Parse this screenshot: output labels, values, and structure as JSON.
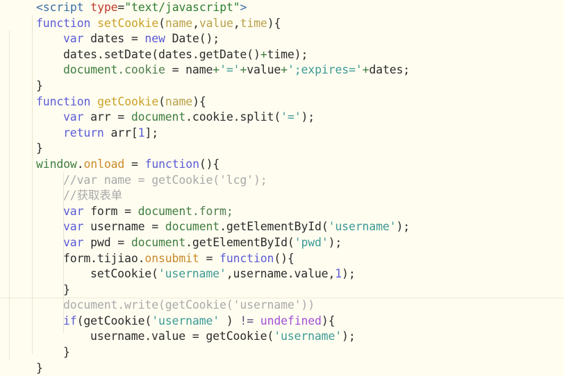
{
  "editor": {
    "name": "code-editor",
    "language": "html-javascript",
    "background_color": "#fffdf0",
    "guide_color": "#e8e4cf",
    "rule_color": "#eeead8",
    "colors": {
      "tag": "#3a6ea5",
      "attribute": "#c0392b",
      "attribute_string": "#2e7d32",
      "keyword": "#5b5bd6",
      "function_name": "#c9a227",
      "property": "#c98a2b",
      "parameter": "#b8a04a",
      "global": "#3f7d3f",
      "string": "#3c9a96",
      "number": "#5b5bd6",
      "comment": "#a9a9a9",
      "undefined_literal": "#a34fd6",
      "operator": "#5a4d7a",
      "default": "#2b2b2b"
    }
  },
  "code": {
    "line01": {
      "t1": "<script ",
      "t2": "type",
      "t3": "=",
      "t4": "\"text/javascript\"",
      "t5": ">"
    },
    "line02": {
      "t1": "function ",
      "t2": "setCookie",
      "t3": "(",
      "t4": "name",
      "t5": ",",
      "t6": "value",
      "t7": ",",
      "t8": "time",
      "t9": "){"
    },
    "line03": {
      "t1": "var ",
      "t2": "dates ",
      "t3": "= ",
      "t4": "new ",
      "t5": "Date();"
    },
    "line04": {
      "t1": "dates",
      "t2": ".setDate(",
      "t3": "dates",
      "t4": ".getDate()",
      "t5": "+",
      "t6": "time);"
    },
    "line05": {
      "t1": "document",
      "t2": ".cookie ",
      "t3": "= ",
      "t4": "name",
      "t5": "+",
      "t6": "'='",
      "t7": "+",
      "t8": "value",
      "t9": "+",
      "t10": "';expires='",
      "t11": "+",
      "t12": "dates;"
    },
    "line06": {
      "t1": "}"
    },
    "line07": {
      "t1": "function ",
      "t2": "getCookie",
      "t3": "(",
      "t4": "name",
      "t5": "){"
    },
    "line08": {
      "t1": "var ",
      "t2": "arr ",
      "t3": "= ",
      "t4": "document",
      "t5": ".cookie.split(",
      "t6": "'='",
      "t7": ");"
    },
    "line09": {
      "t1": "return ",
      "t2": "arr[",
      "t3": "1",
      "t4": "];"
    },
    "line10": {
      "t1": "}"
    },
    "line11": {
      "t1": "window",
      "t2": ".",
      "t3": "onload ",
      "t4": "= ",
      "t5": "function",
      "t6": "(){"
    },
    "line12": {
      "t1": "//var name = getCookie('lcg');"
    },
    "line13": {
      "t1": "//获取表单"
    },
    "line14": {
      "t1": "var ",
      "t2": "form ",
      "t3": "= ",
      "t4": "document",
      "t5": ".form;"
    },
    "line15": {
      "t1": "var ",
      "t2": "username ",
      "t3": "= ",
      "t4": "document",
      "t5": ".getElementById(",
      "t6": "'username'",
      "t7": ");"
    },
    "line16": {
      "t1": "var ",
      "t2": "pwd ",
      "t3": "= ",
      "t4": "document",
      "t5": ".getElementById(",
      "t6": "'pwd'",
      "t7": ");"
    },
    "line17": {
      "t1": "form.tijiao.",
      "t2": "onsubmit ",
      "t3": "= ",
      "t4": "function",
      "t5": "(){"
    },
    "line18": {
      "t1": "setCookie(",
      "t2": "'username'",
      "t3": ",username.value,",
      "t4": "1",
      "t5": ");"
    },
    "line19": {
      "t1": "}"
    },
    "line20": {
      "t1": "document.write(getCookie('username'))"
    },
    "line21": {
      "t1": "if",
      "t2": "(getCookie(",
      "t3": "'username'",
      "t4": " ) ",
      "t5": "!=",
      "t6": " ",
      "t7": "undefined",
      "t8": "){"
    },
    "line22": {
      "t1": "username.value ",
      "t2": "= ",
      "t3": "getCookie(",
      "t4": "'username'",
      "t5": ");"
    },
    "line23": {
      "t1": "}"
    },
    "line24": {
      "t1": "}"
    }
  }
}
